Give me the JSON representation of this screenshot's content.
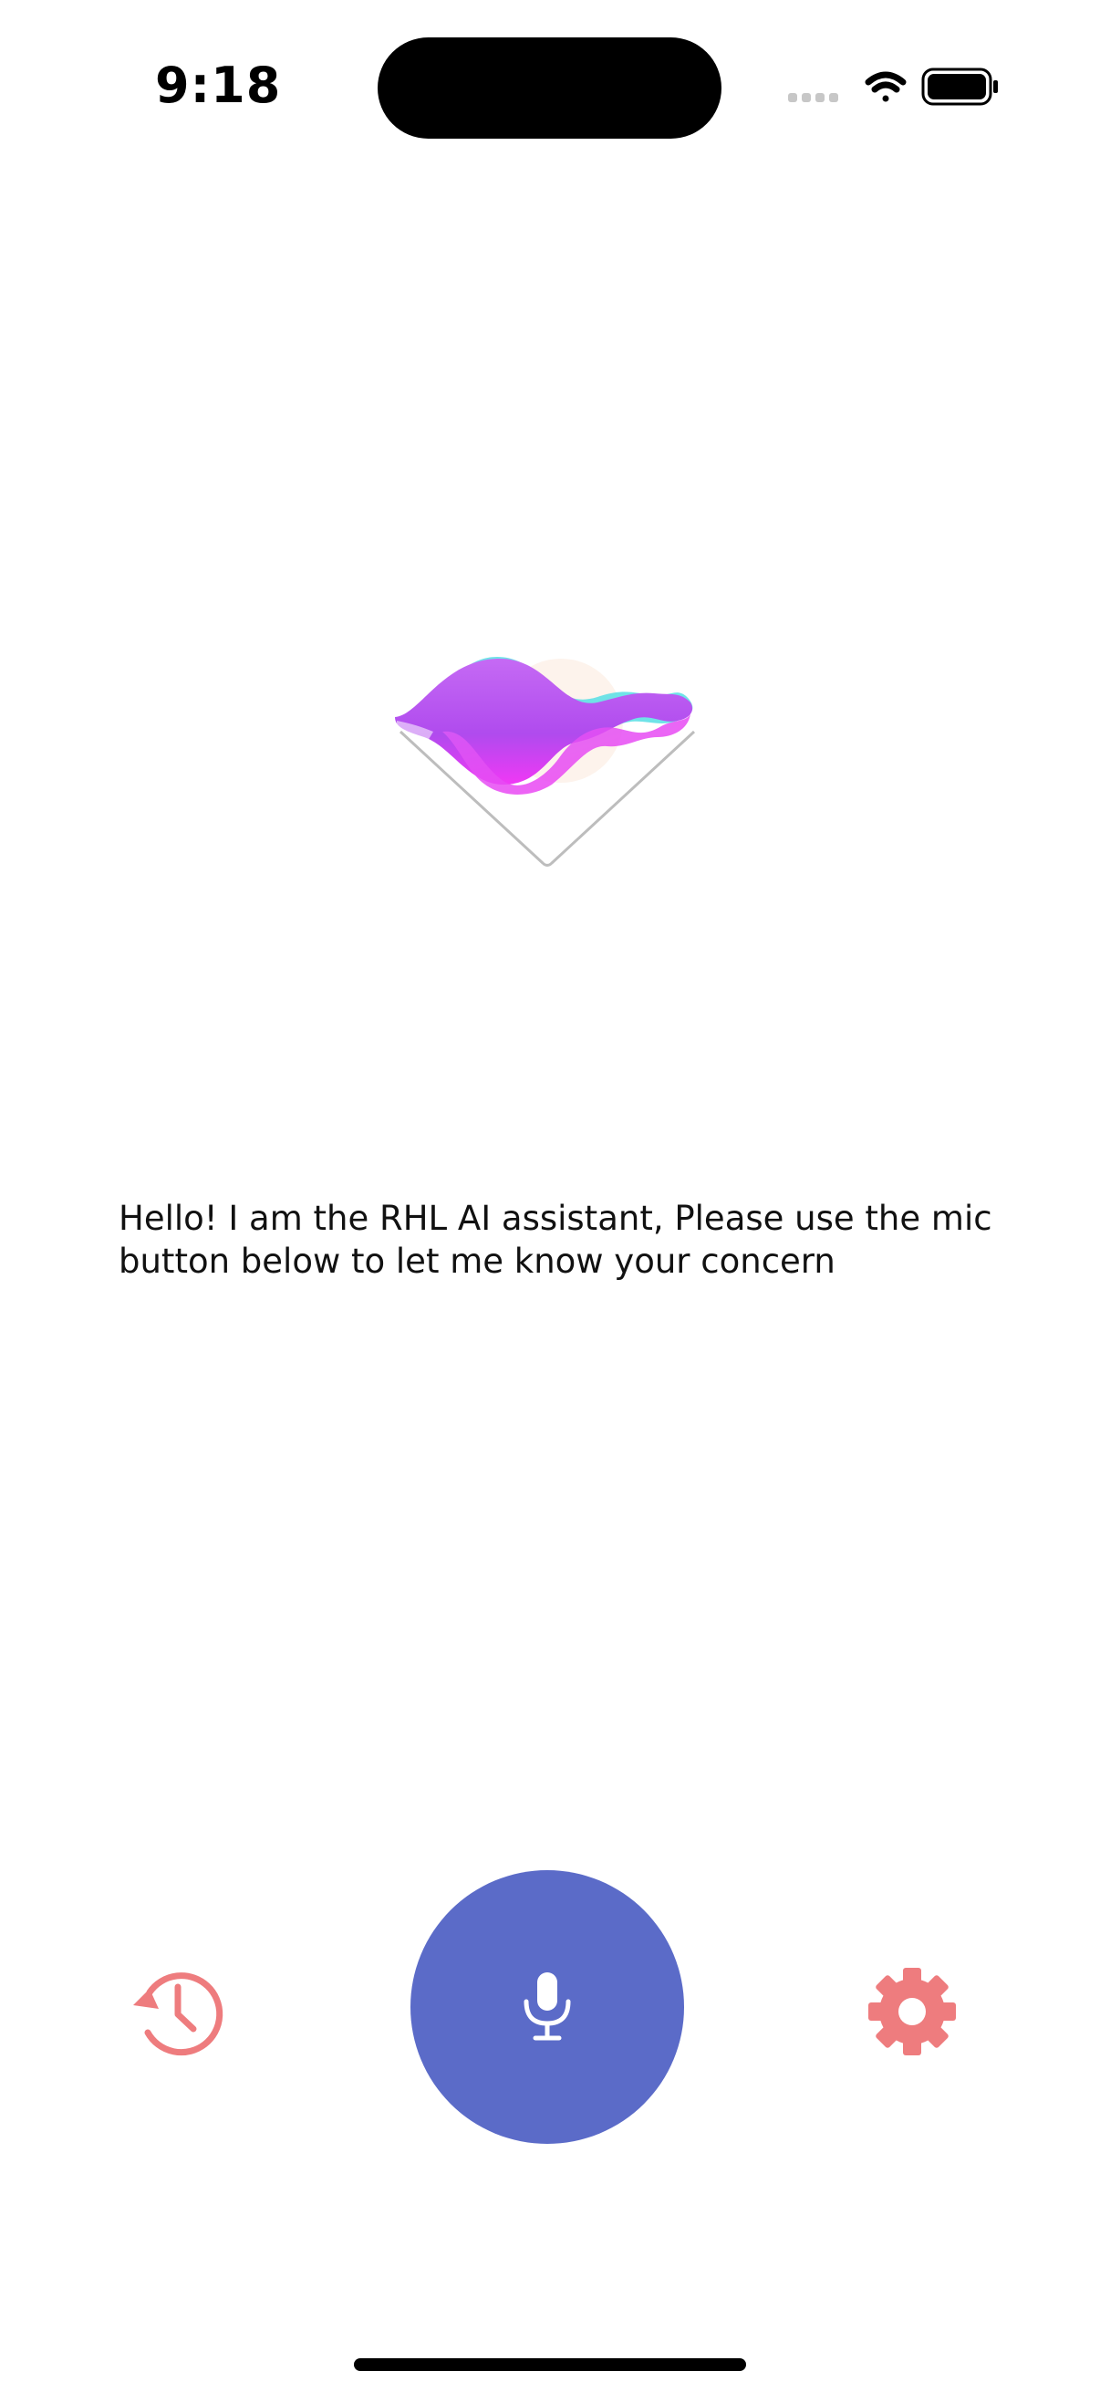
{
  "status_bar": {
    "time": "9:18",
    "signal_icon": "cellular-signal-icon",
    "wifi_icon": "wifi-icon",
    "battery_icon": "battery-icon"
  },
  "assistant": {
    "visual_icon": "voice-wave-icon",
    "greeting": "Hello! I am the RHL AI assistant, Please use the mic button below to let me know your concern"
  },
  "controls": {
    "history_icon": "history-icon",
    "mic_icon": "microphone-icon",
    "settings_icon": "gear-icon"
  },
  "colors": {
    "mic_button": "#5B6BC8",
    "accent_icons": "#EE7C7E",
    "wave_purple": "#B45BF0",
    "wave_magenta": "#F03CF0",
    "wave_cyan": "#5FE0E6"
  }
}
